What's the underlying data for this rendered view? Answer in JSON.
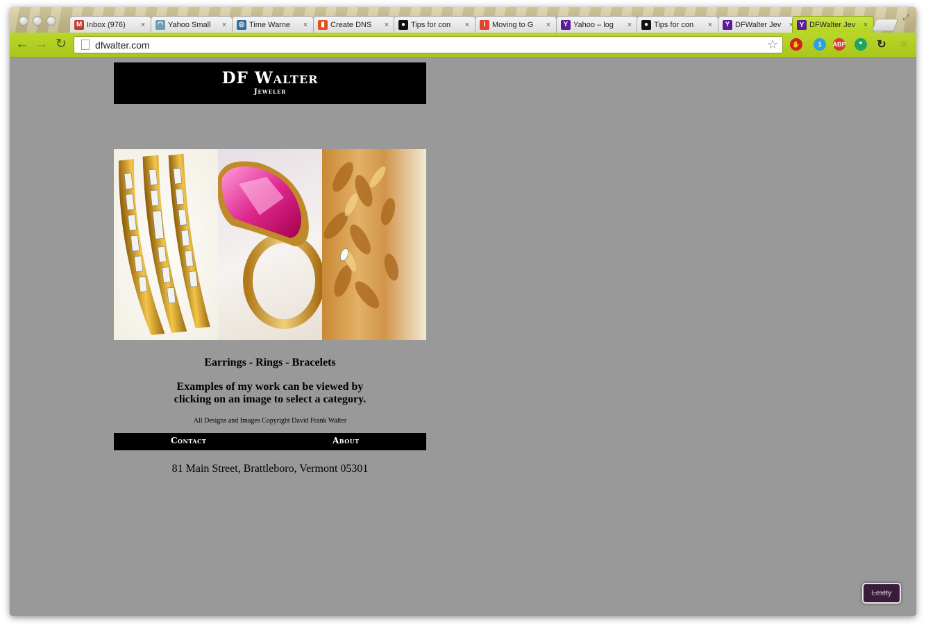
{
  "browser": {
    "tabs": [
      {
        "title": "Inbox (976)",
        "icon": "gmail-icon",
        "fav_color": "#c43c2b",
        "fav_glyph": "M"
      },
      {
        "title": "Yahoo Small",
        "icon": "loading-icon",
        "fav_color": "#6aa0b0",
        "fav_glyph": "◠"
      },
      {
        "title": "Time Warne",
        "icon": "time-warner-icon",
        "fav_color": "#2f6fa0",
        "fav_glyph": "◎"
      },
      {
        "title": "Create DNS",
        "icon": "office-icon",
        "fav_color": "#e3501c",
        "fav_glyph": "▮"
      },
      {
        "title": "Tips for con",
        "icon": "github-icon",
        "fav_color": "#111111",
        "fav_glyph": "●"
      },
      {
        "title": "Moving to G",
        "icon": "red-square-icon",
        "fav_color": "#e0442a",
        "fav_glyph": "I"
      },
      {
        "title": "Yahoo – log",
        "icon": "yahoo-icon",
        "fav_color": "#5b1b9c",
        "fav_glyph": "Y"
      },
      {
        "title": "Tips for con",
        "icon": "github-icon",
        "fav_color": "#111111",
        "fav_glyph": "●"
      },
      {
        "title": "DFWalter Jev",
        "icon": "yahoo-icon",
        "fav_color": "#5b1b9c",
        "fav_glyph": "Y"
      },
      {
        "title": "DFWalter Jev",
        "icon": "yahoo-icon",
        "fav_color": "#5b1b9c",
        "fav_glyph": "Y",
        "active": true
      }
    ],
    "close_glyph": "×",
    "url": "dfwalter.com",
    "extensions": [
      {
        "name": "stop-extension-icon",
        "color": "#d21f1f",
        "glyph": "✋"
      },
      {
        "name": "ghostery-icon",
        "color": "#29a3d8",
        "glyph": "1"
      },
      {
        "name": "adblock-icon",
        "color": "#d83a2a",
        "glyph": "ABP"
      },
      {
        "name": "hangouts-icon",
        "color": "#1fa463",
        "glyph": "❞"
      },
      {
        "name": "sync-icon",
        "color": "#222222",
        "glyph": "↻"
      },
      {
        "name": "menu-icon",
        "color": "#c79a16",
        "glyph": "≡"
      }
    ]
  },
  "page": {
    "brand": "DF Walter",
    "tagline": "Jeweler",
    "categories": "Earrings - Rings - Bracelets",
    "intro_line1": "Examples of my work can be viewed by",
    "intro_line2": "clicking on an image to select a category.",
    "copyright": "All Designs and Images Copyright David Frank Walter",
    "nav": {
      "contact": "Contact",
      "about": "About"
    },
    "address": "81 Main Street, Brattleboro, Vermont 05301",
    "lexity_label": "Lexity"
  }
}
